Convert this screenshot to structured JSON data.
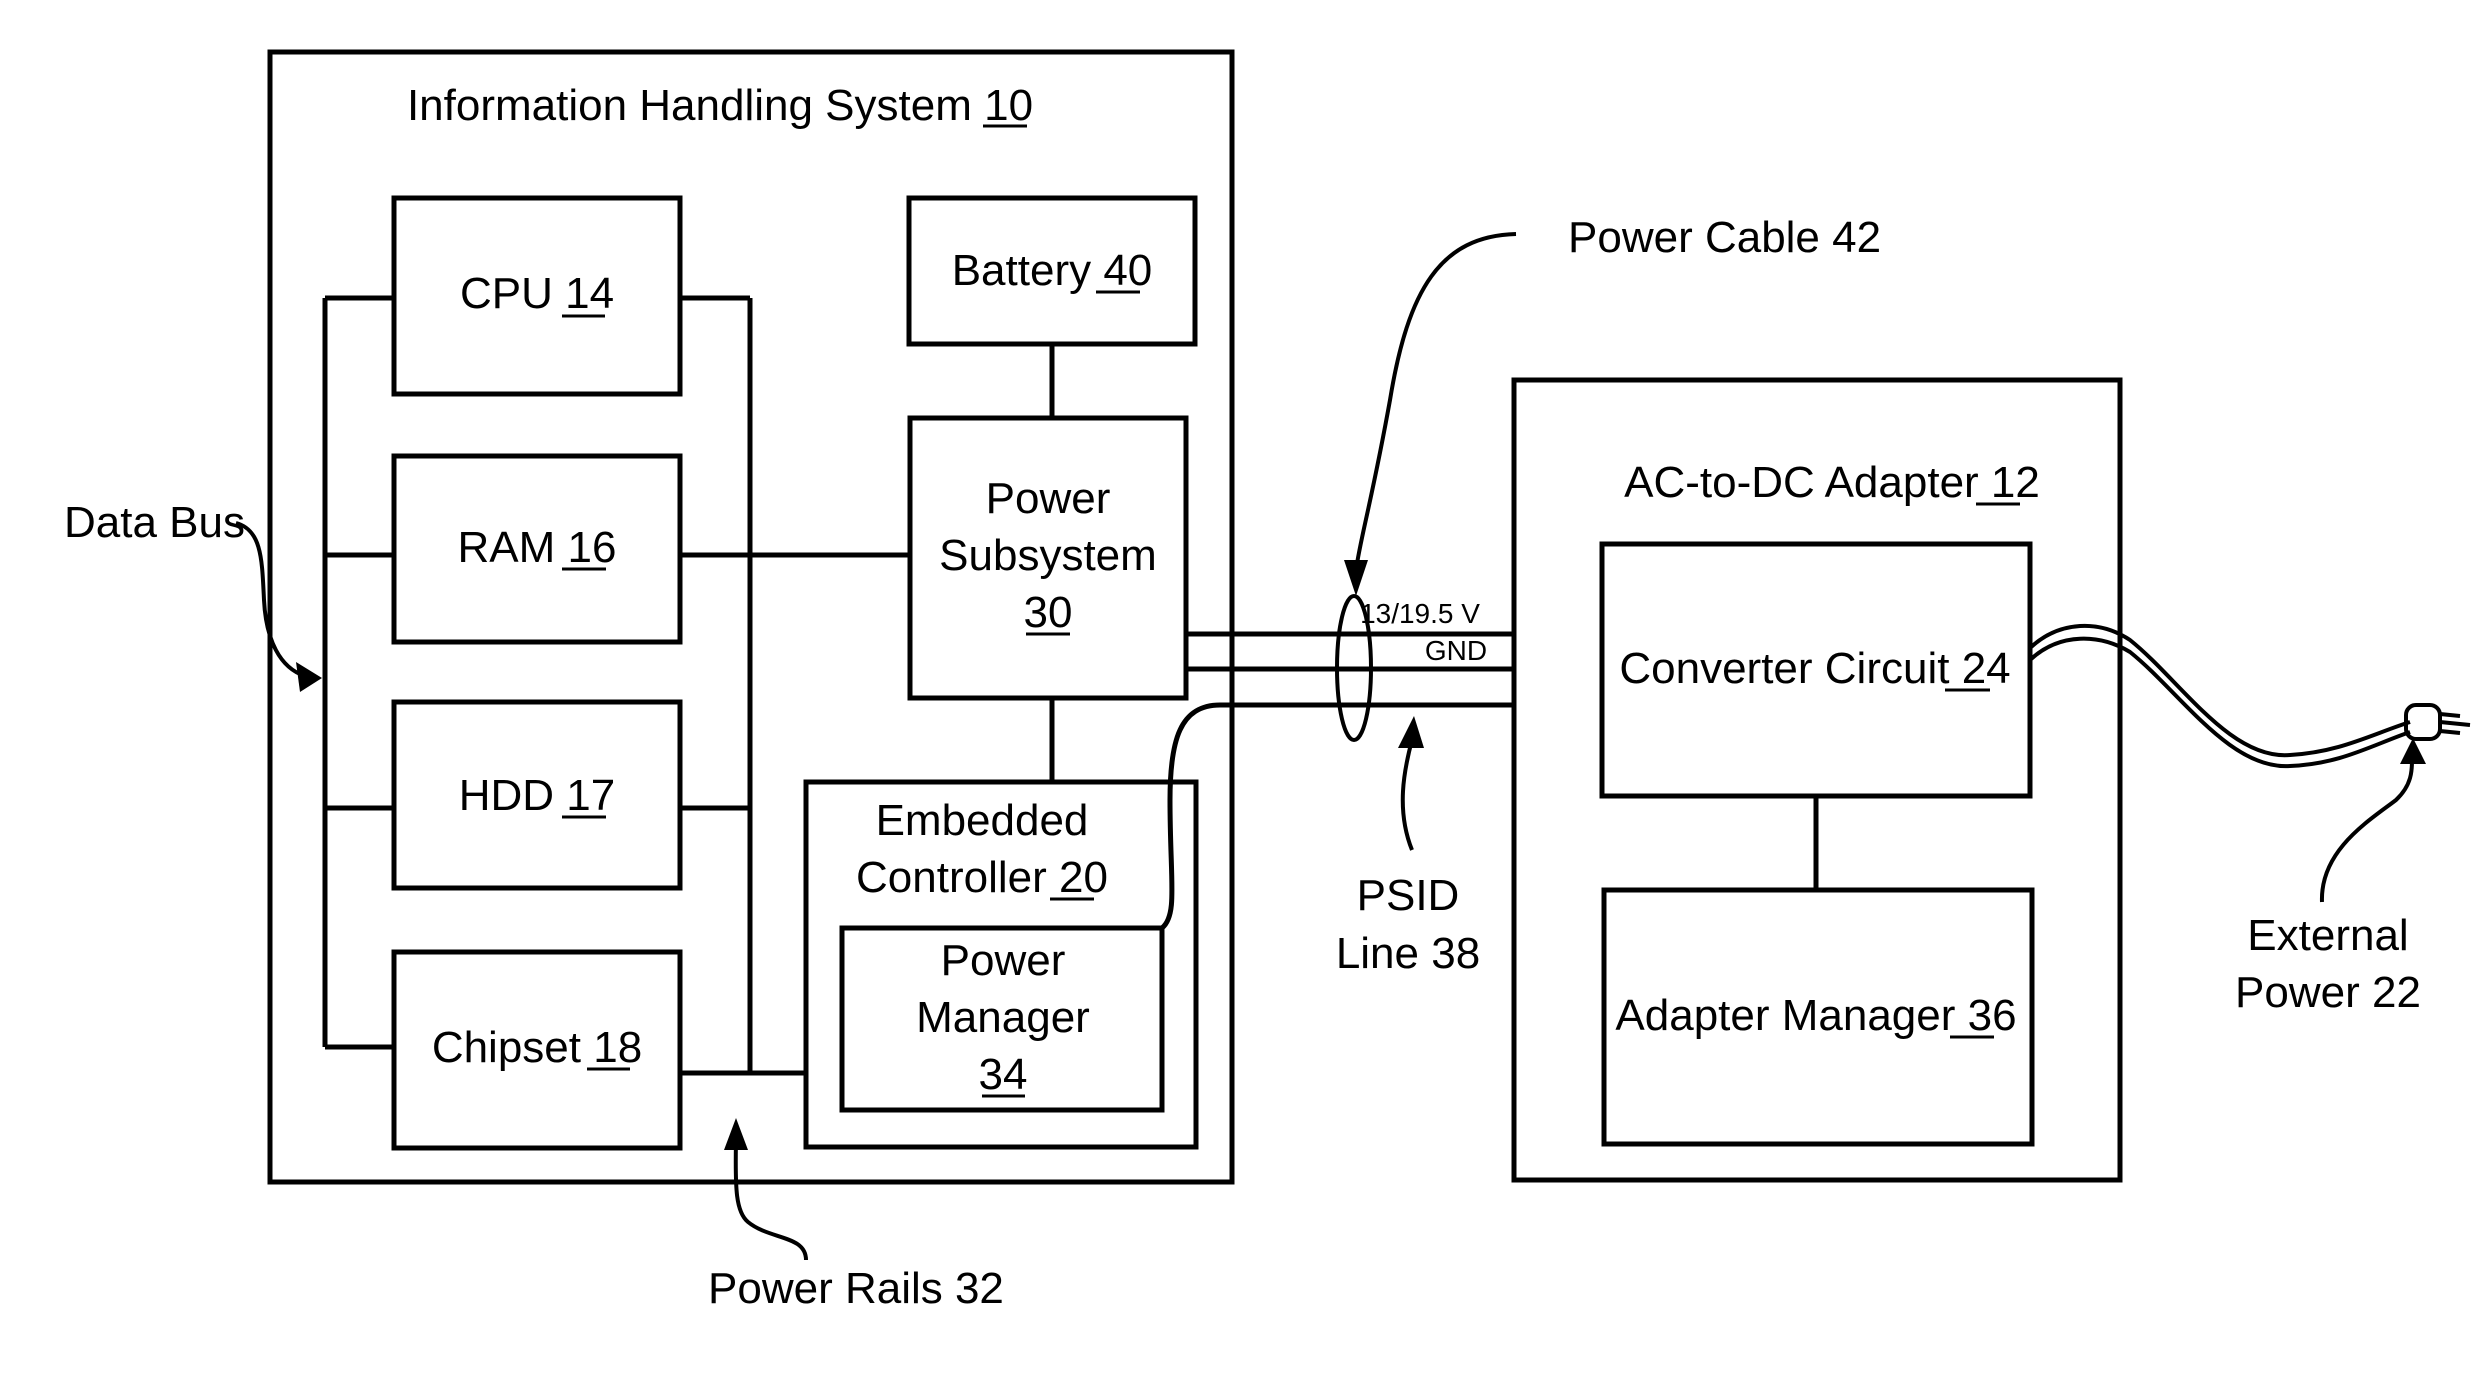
{
  "figure": {
    "system": {
      "name": "Information Handling System",
      "ref": "10"
    },
    "components": {
      "cpu": {
        "name": "CPU",
        "ref": "14"
      },
      "ram": {
        "name": "RAM",
        "ref": "16"
      },
      "hdd": {
        "name": "HDD",
        "ref": "17"
      },
      "chipset": {
        "name": "Chipset",
        "ref": "18"
      },
      "battery": {
        "name": "Battery",
        "ref": "40"
      },
      "power_subsystem": {
        "line1": "Power",
        "line2": "Subsystem",
        "ref": "30"
      },
      "embedded_controller": {
        "line1": "Embedded",
        "line2": "Controller",
        "ref": "20"
      },
      "power_manager": {
        "line1": "Power",
        "line2": "Manager",
        "ref": "34"
      }
    },
    "adapter": {
      "name": "AC-to-DC Adapter",
      "ref": "12",
      "converter": {
        "name": "Converter Circuit",
        "ref": "24"
      },
      "manager": {
        "name": "Adapter Manager",
        "ref": "36"
      }
    },
    "callouts": {
      "data_bus": "Data Bus",
      "power_rails": "Power Rails 32",
      "power_cable": "Power Cable 42",
      "psid_line1": "PSID",
      "psid_line2": "Line 38",
      "external_line1": "External",
      "external_line2": "Power 22"
    },
    "cable_labels": {
      "voltage": "13/19.5 V",
      "ground": "GND"
    }
  }
}
